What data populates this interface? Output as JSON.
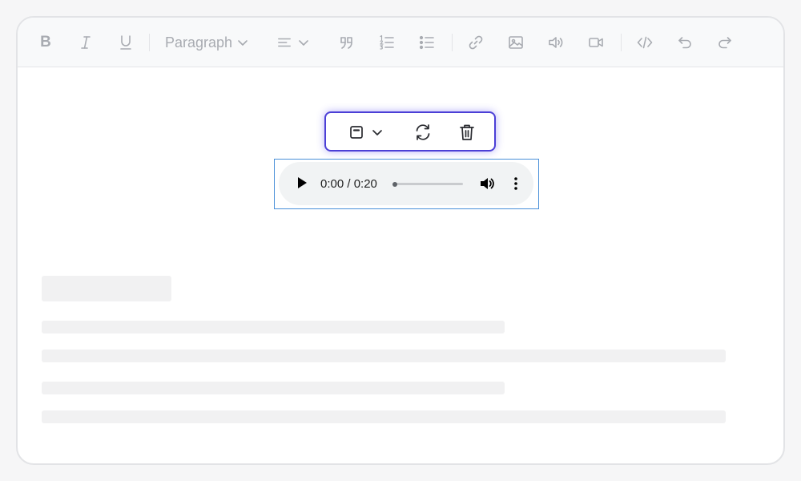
{
  "toolbar": {
    "bold_label": "B",
    "block_style_value": "Paragraph",
    "icons": [
      "bold-icon",
      "italic-icon",
      "underline-icon",
      "align-left-icon",
      "chevron-down-icon",
      "blockquote-icon",
      "ordered-list-icon",
      "bullet-list-icon",
      "link-icon",
      "image-icon",
      "audio-icon",
      "video-icon",
      "code-icon",
      "undo-icon",
      "redo-icon"
    ]
  },
  "floating_toolbar": {
    "icons": [
      "display-mode-icon",
      "chevron-down-icon",
      "replace-icon",
      "delete-icon"
    ]
  },
  "audio_player": {
    "time_display": "0:00 / 0:20",
    "progress_fraction": 0,
    "icons": [
      "play-icon",
      "volume-icon",
      "more-options-icon"
    ]
  },
  "colors": {
    "accent": "#4b3fd6",
    "selection_border": "#4a90d9",
    "toolbar_icon": "#a8abb1",
    "skeleton": "#f1f1f2"
  }
}
